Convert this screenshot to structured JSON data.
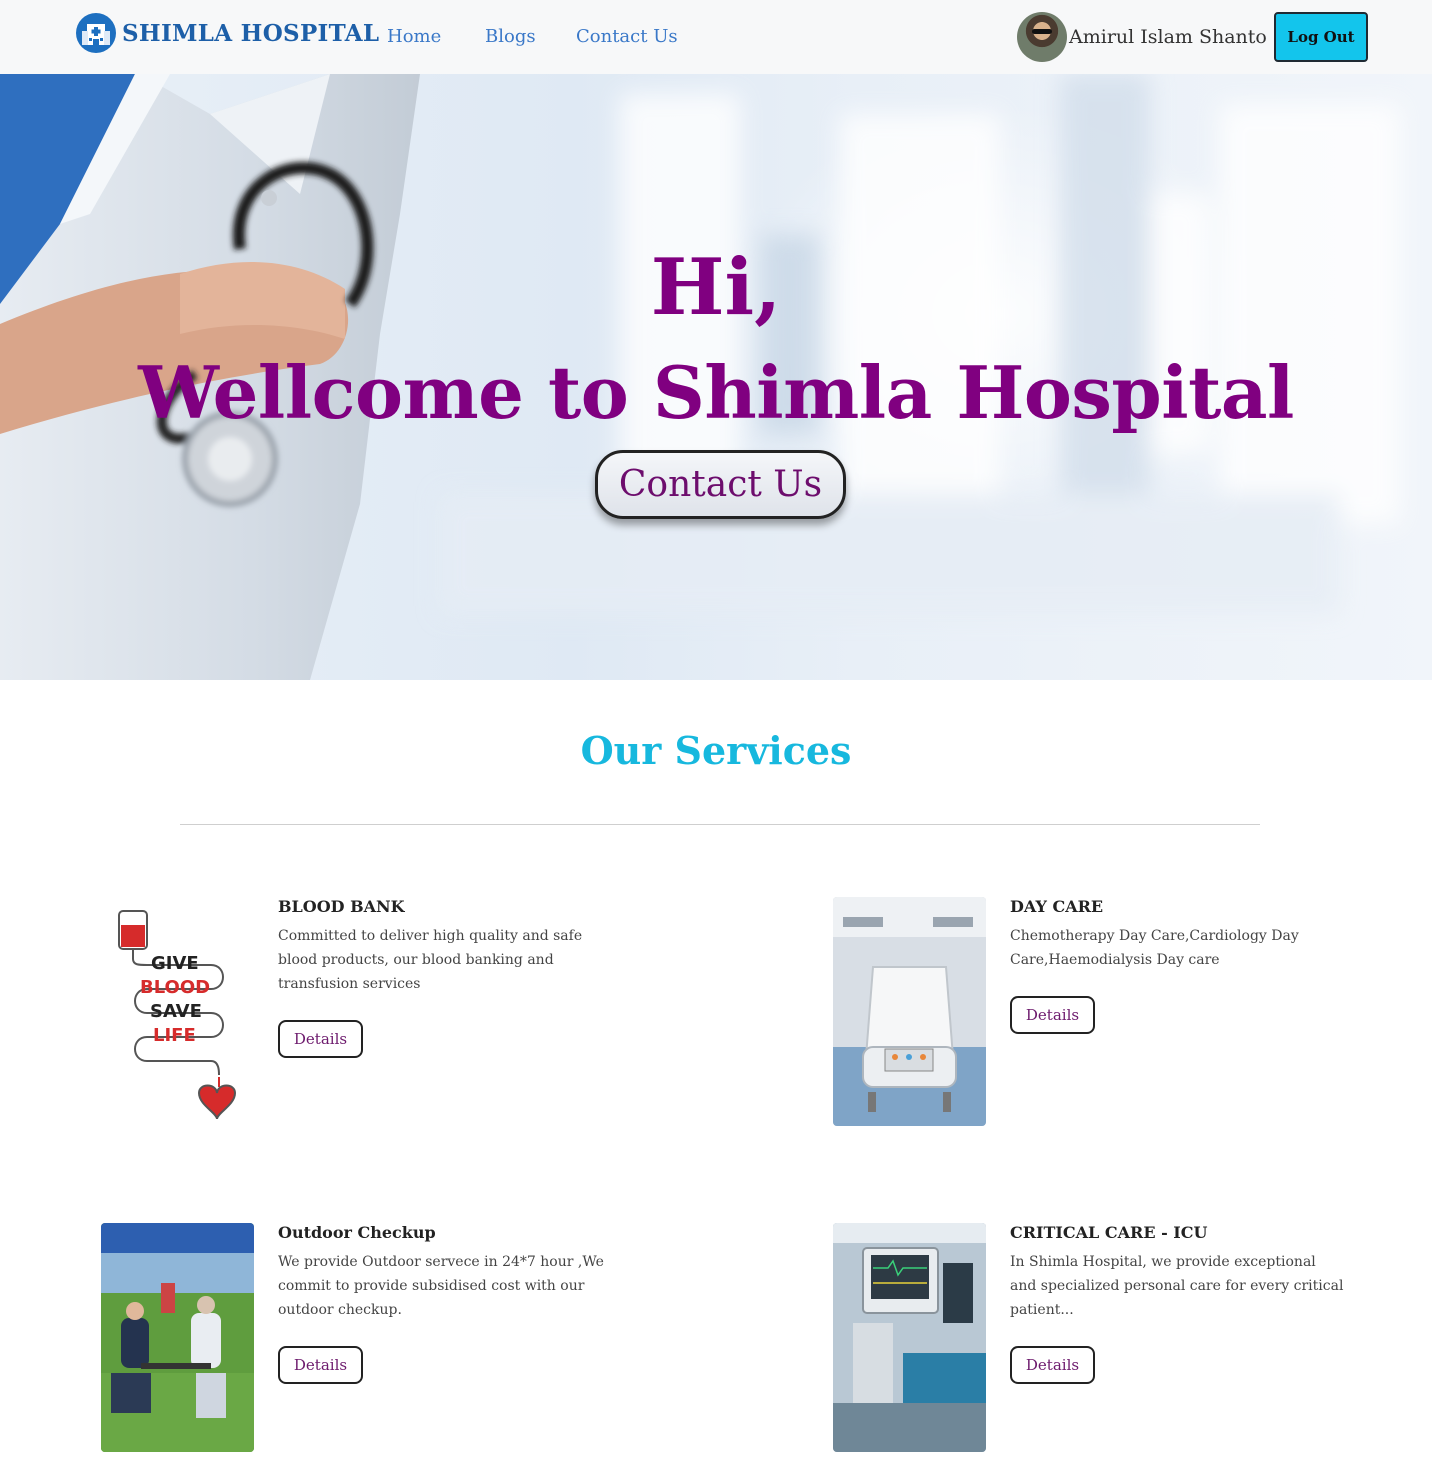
{
  "navbar": {
    "brand_name": "SHIMLA HOSPITAL",
    "brand_icon": "hospital-icon",
    "links": [
      {
        "label": "Home"
      },
      {
        "label": "Blogs"
      },
      {
        "label": "Contact Us"
      }
    ],
    "user_name": "Amirul Islam Shanto",
    "logout_label": "Log Out"
  },
  "hero": {
    "greeting": "Hi,",
    "headline": "Wellcome to Shimla Hospital",
    "cta_label": "Contact Us"
  },
  "services": {
    "title": "Our Services",
    "items": [
      {
        "title": "BLOOD BANK",
        "description": "Committed to deliver high quality and safe blood products, our blood banking and transfusion services",
        "button": "Details",
        "image_text": [
          "GIVE",
          "BLOOD",
          "SAVE",
          "LIFE"
        ]
      },
      {
        "title": "DAY CARE",
        "description": "Chemotherapy Day Care,Cardiology Day Care,Haemodialysis Day care",
        "button": "Details"
      },
      {
        "title": "Outdoor Checkup",
        "description": "We provide Outdoor servece in 24*7 hour ,We commit to provide subsidised cost with our outdoor checkup.",
        "button": "Details"
      },
      {
        "title": "CRITICAL CARE - ICU",
        "description": "In Shimla Hospital, we provide exceptional and specialized personal care for every critical patient...",
        "button": "Details"
      }
    ]
  },
  "colors": {
    "brand_blue": "#1d5fa8",
    "link_blue": "#3a78c8",
    "hero_purple": "#800080",
    "section_cyan": "#17b8de",
    "logout_bg": "#13c5ec"
  }
}
